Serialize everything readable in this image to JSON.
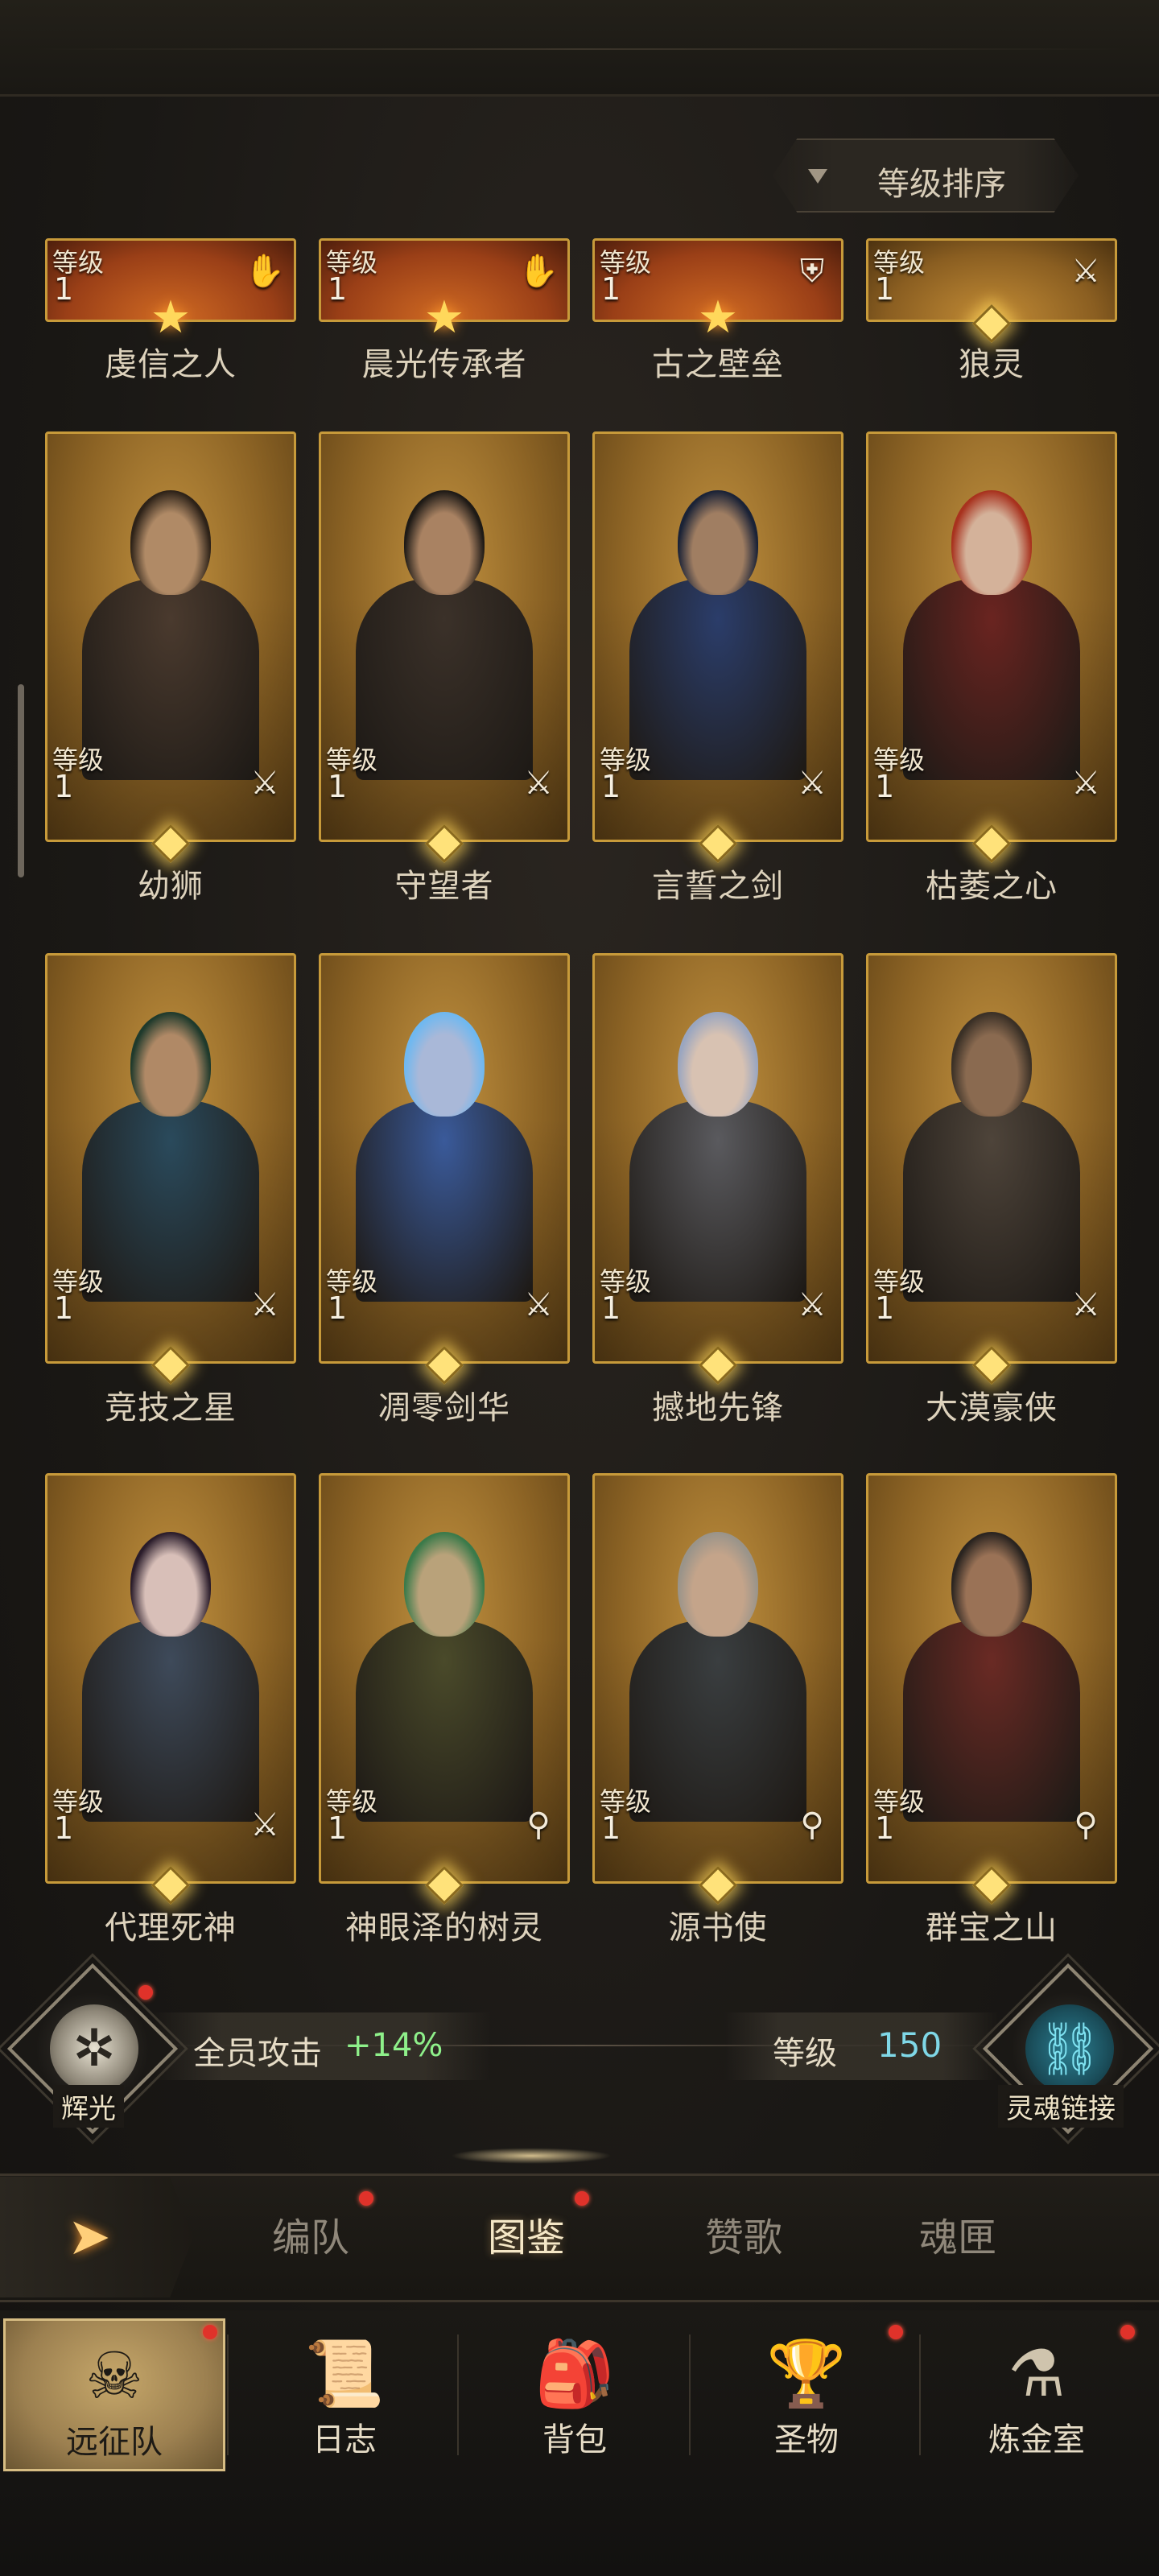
{
  "sort": {
    "label": "等级排序"
  },
  "level_label": "等级",
  "top_row": [
    {
      "name": "虔信之人",
      "level": "1",
      "icon": "hand-icon",
      "glyph": "✋"
    },
    {
      "name": "晨光传承者",
      "level": "1",
      "icon": "hand-icon",
      "glyph": "✋"
    },
    {
      "name": "古之壁垒",
      "level": "1",
      "icon": "shield-icon",
      "glyph": "⛨"
    },
    {
      "name": "狼灵",
      "level": "1",
      "icon": "sword-icon",
      "glyph": "⚔"
    }
  ],
  "heroes": [
    {
      "name": "幼狮",
      "level": "1",
      "icon": "sword-icon",
      "glyph": "⚔",
      "hair": "#2d2218",
      "skin": "#b08a66",
      "cloth": "#4a3a2e"
    },
    {
      "name": "守望者",
      "level": "1",
      "icon": "sword-icon",
      "glyph": "⚔",
      "hair": "#1e1a16",
      "skin": "#a98262",
      "cloth": "#3b3129"
    },
    {
      "name": "言誓之剑",
      "level": "1",
      "icon": "sword-icon",
      "glyph": "⚔",
      "hair": "#1a2236",
      "skin": "#a07e62",
      "cloth": "#2b3d6a"
    },
    {
      "name": "枯萎之心",
      "level": "1",
      "icon": "sword-icon",
      "glyph": "⚔",
      "hair": "#a8321e",
      "skin": "#d4b29a",
      "cloth": "#6a2420"
    },
    {
      "name": "竞技之星",
      "level": "1",
      "icon": "sword-icon",
      "glyph": "⚔",
      "hair": "#1f3a2c",
      "skin": "#b08966",
      "cloth": "#2a4a5c"
    },
    {
      "name": "凋零剑华",
      "level": "1",
      "icon": "sword-icon",
      "glyph": "⚔",
      "hair": "#6fb8f0",
      "skin": "#a9b8d8",
      "cloth": "#3a5a9a"
    },
    {
      "name": "撼地先锋",
      "level": "1",
      "icon": "sword-icon",
      "glyph": "⚔",
      "hair": "#9aa6c0",
      "skin": "#d8c2b2",
      "cloth": "#5a5a5e"
    },
    {
      "name": "大漠豪侠",
      "level": "1",
      "icon": "sword-icon",
      "glyph": "⚔",
      "hair": "#3a3026",
      "skin": "#8a6a50",
      "cloth": "#4e443a"
    },
    {
      "name": "代理死神",
      "level": "1",
      "icon": "sword-icon",
      "glyph": "⚔",
      "hair": "#2a1c2a",
      "skin": "#d8bfb8",
      "cloth": "#3e4a5a"
    },
    {
      "name": "神眼泽的树灵",
      "level": "1",
      "icon": "staff-icon",
      "glyph": "⚲",
      "hair": "#3a7a4a",
      "skin": "#b9a27a",
      "cloth": "#4a4a2a"
    },
    {
      "name": "源书使",
      "level": "1",
      "icon": "staff-icon",
      "glyph": "⚲",
      "hair": "#9a948a",
      "skin": "#c4a48a",
      "cloth": "#3a3e40"
    },
    {
      "name": "群宝之山",
      "level": "1",
      "icon": "staff-icon",
      "glyph": "⚲",
      "hair": "#2a2420",
      "skin": "#9a7256",
      "cloth": "#6a2a24"
    }
  ],
  "stats": {
    "left_emblem_label": "辉光",
    "attack_label": "全员攻击",
    "attack_value": "+14%",
    "level_label": "等级",
    "level_value": "150",
    "right_emblem_label": "灵魂链接"
  },
  "tabs": [
    {
      "label": "编队",
      "active": false
    },
    {
      "label": "图鉴",
      "active": true
    },
    {
      "label": "赞歌",
      "active": false
    },
    {
      "label": "魂匣",
      "active": false
    }
  ],
  "nav": [
    {
      "label": "远征队",
      "icon": "helmet-icon",
      "glyph": "☠",
      "active": true
    },
    {
      "label": "日志",
      "icon": "scroll-icon",
      "glyph": "📜",
      "active": false
    },
    {
      "label": "背包",
      "icon": "bag-icon",
      "glyph": "🎒",
      "active": false
    },
    {
      "label": "圣物",
      "icon": "chalice-icon",
      "glyph": "🏆",
      "active": false
    },
    {
      "label": "炼金室",
      "icon": "alchemy-icon",
      "glyph": "⚗",
      "active": false
    }
  ],
  "colors": {
    "card_border": "#c79a3a",
    "accent_green": "#8ef08a",
    "accent_cyan": "#7fd7e6",
    "notification_red": "#e0322a"
  }
}
